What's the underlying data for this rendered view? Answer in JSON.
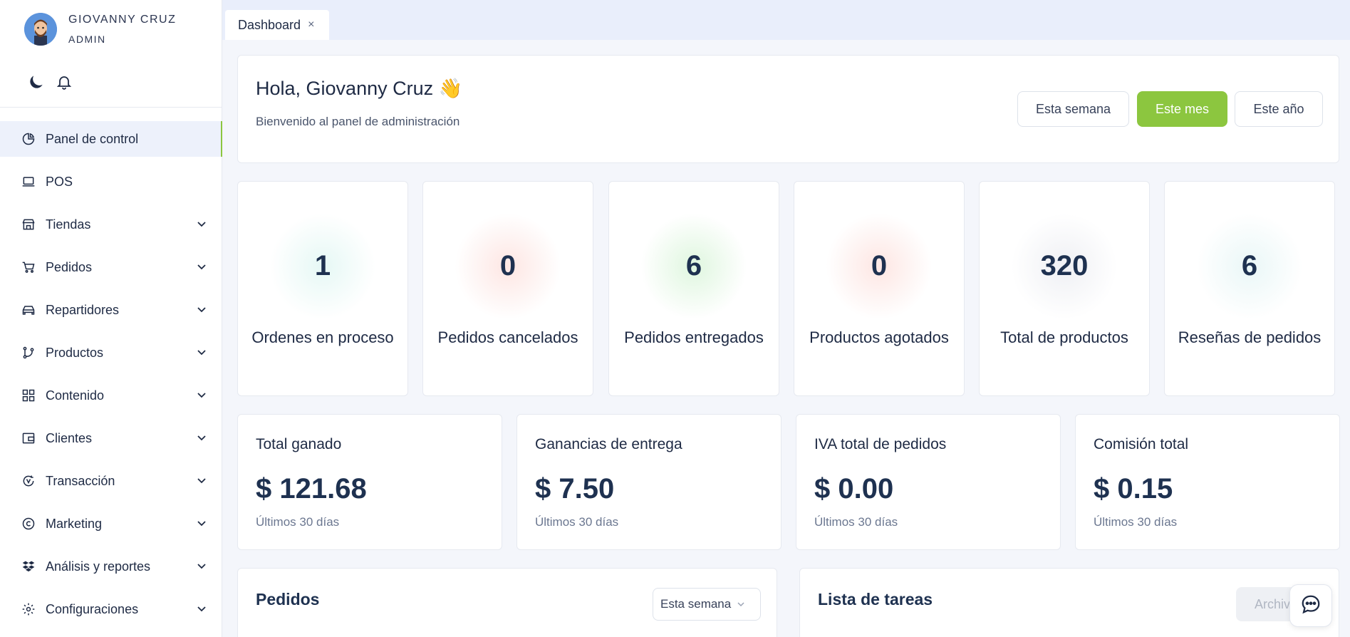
{
  "user": {
    "name": "GIOVANNY CRUZ",
    "role": "ADMIN"
  },
  "nav": [
    {
      "label": "Panel de control",
      "icon": "pie-chart-icon",
      "active": true
    },
    {
      "label": "POS",
      "icon": "laptop-icon"
    },
    {
      "label": "Tiendas",
      "icon": "store-icon"
    },
    {
      "label": "Pedidos",
      "icon": "cart-icon"
    },
    {
      "label": "Repartidores",
      "icon": "car-icon"
    },
    {
      "label": "Productos",
      "icon": "branch-icon"
    },
    {
      "label": "Contenido",
      "icon": "layout-icon"
    },
    {
      "label": "Clientes",
      "icon": "wallet-icon"
    },
    {
      "label": "Transacción",
      "icon": "refresh-dollar-icon"
    },
    {
      "label": "Marketing",
      "icon": "copyright-icon"
    },
    {
      "label": "Análisis y reportes",
      "icon": "dropbox-icon"
    },
    {
      "label": "Configuraciones",
      "icon": "gear-icon"
    }
  ],
  "tab": {
    "label": "Dashboard",
    "close": "×"
  },
  "welcome": {
    "greeting": "Hola, Giovanny Cruz 👋",
    "subtitle": "Bienvenido al panel de administración",
    "periods": [
      "Esta semana",
      "Este mes",
      "Este año"
    ],
    "active_period": "Este mes"
  },
  "stats": [
    {
      "value": "1",
      "label": "Ordenes en proceso",
      "glow": "#e8f8f6"
    },
    {
      "value": "0",
      "label": "Pedidos cancelados",
      "glow": "#fdecea"
    },
    {
      "value": "6",
      "label": "Pedidos entregados",
      "glow": "#e4f8e4"
    },
    {
      "value": "0",
      "label": "Productos agotados",
      "glow": "#fdecea"
    },
    {
      "value": "320",
      "label": "Total de productos",
      "glow": "#f1f2f5"
    },
    {
      "value": "6",
      "label": "Reseñas de pedidos",
      "glow": "#eef8f8"
    }
  ],
  "earnings": [
    {
      "title": "Total ganado",
      "value": "$ 121.68",
      "sub": "Últimos 30 días"
    },
    {
      "title": "Ganancias de entrega",
      "value": "$ 7.50",
      "sub": "Últimos 30 días"
    },
    {
      "title": "IVA total de pedidos",
      "value": "$ 0.00",
      "sub": "Últimos 30 días"
    },
    {
      "title": "Comisión total",
      "value": "$ 0.15",
      "sub": "Últimos 30 días"
    }
  ],
  "orders_panel": {
    "title": "Pedidos",
    "select_value": "Esta semana"
  },
  "tasks_panel": {
    "title": "Lista de tareas",
    "button": "Archivar"
  },
  "colors": {
    "accent": "#8cc63f",
    "text": "#1e3150"
  }
}
